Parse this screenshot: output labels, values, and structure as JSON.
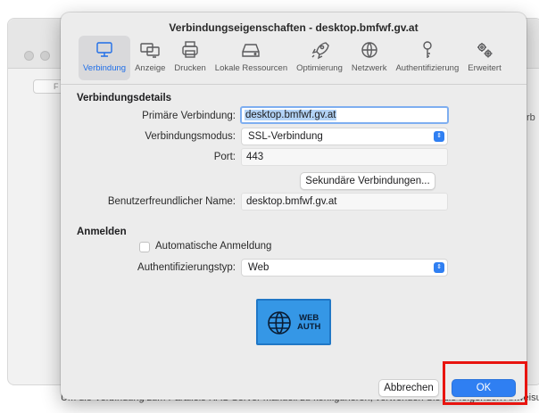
{
  "background": {
    "button_label": "F",
    "side_text": "rb",
    "bottom_text": "Um die Verbindung zum Parallels RAS Server manuell zu konfigurieren, verwenden Sie die folgenden Anweisungen"
  },
  "dialog": {
    "title": "Verbindungseigenschaften - desktop.bmfwf.gv.at",
    "toolbar": [
      {
        "label": "Verbindung",
        "icon": "monitor-icon",
        "active": true
      },
      {
        "label": "Anzeige",
        "icon": "displays-icon",
        "active": false
      },
      {
        "label": "Drucken",
        "icon": "printer-icon",
        "active": false
      },
      {
        "label": "Lokale Ressourcen",
        "icon": "drive-icon",
        "active": false
      },
      {
        "label": "Optimierung",
        "icon": "rocket-icon",
        "active": false
      },
      {
        "label": "Netzwerk",
        "icon": "globe-icon",
        "active": false
      },
      {
        "label": "Authentifizierung",
        "icon": "key-icon",
        "active": false
      },
      {
        "label": "Erweitert",
        "icon": "gears-icon",
        "active": false
      }
    ],
    "connection_section": {
      "heading": "Verbindungsdetails",
      "primary_label": "Primäre Verbindung:",
      "primary_value": "desktop.bmfwf.gv.at",
      "mode_label": "Verbindungsmodus:",
      "mode_value": "SSL-Verbindung",
      "port_label": "Port:",
      "port_value": "443",
      "secondary_button": "Sekundäre Verbindungen...",
      "friendly_label": "Benutzerfreundlicher Name:",
      "friendly_value": "desktop.bmfwf.gv.at"
    },
    "login_section": {
      "heading": "Anmelden",
      "auto_login_label": "Automatische Anmeldung",
      "auto_login_checked": false,
      "auth_type_label": "Authentifizierungstyp:",
      "auth_type_value": "Web",
      "web_auth_line1": "WEB",
      "web_auth_line2": "AUTH"
    },
    "buttons": {
      "cancel": "Abbrechen",
      "ok": "OK"
    }
  },
  "colors": {
    "accent": "#2f7ff2",
    "highlight": "#e8140f",
    "web_auth": "#3597e6"
  }
}
